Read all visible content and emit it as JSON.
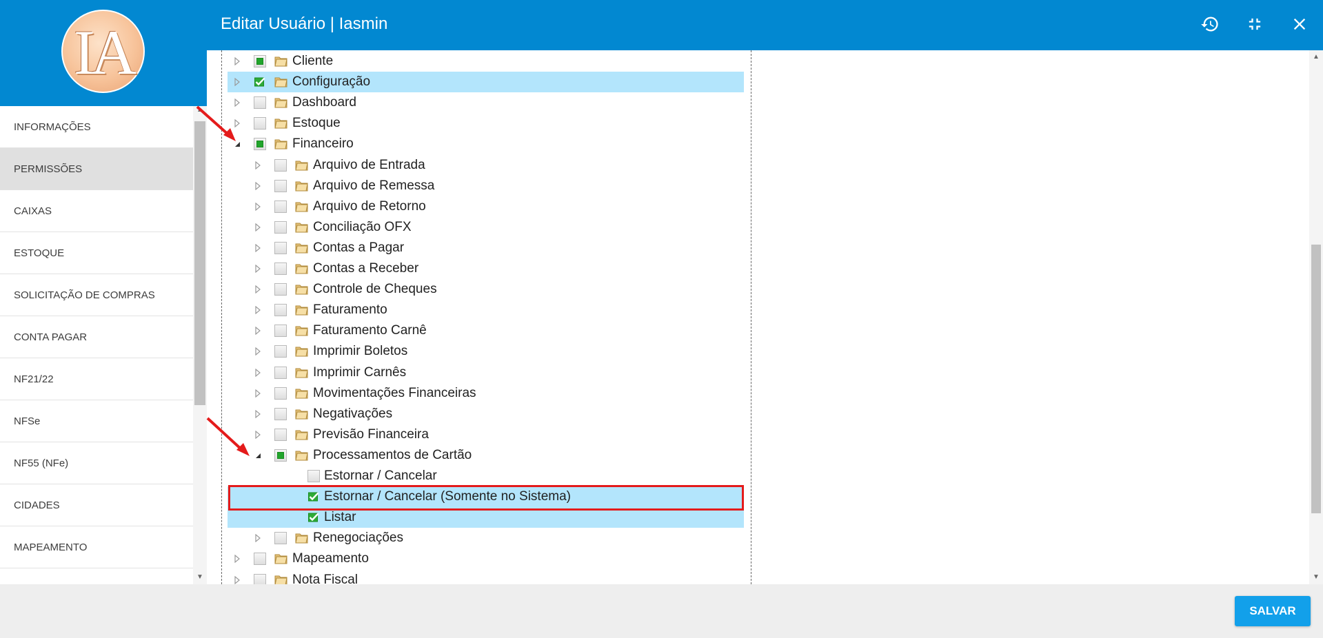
{
  "header": {
    "title": "Editar Usuário | Iasmin",
    "logo_text": "IA",
    "history_icon": "history-icon",
    "collapse_icon": "fullscreen-exit-icon",
    "close_icon": "close-icon",
    "color": "#0288d1"
  },
  "sidebar": {
    "items": [
      {
        "label": "INFORMAÇÕES",
        "active": false
      },
      {
        "label": "PERMISSÕES",
        "active": true
      },
      {
        "label": "CAIXAS",
        "active": false
      },
      {
        "label": "ESTOQUE",
        "active": false
      },
      {
        "label": "SOLICITAÇÃO DE COMPRAS",
        "active": false
      },
      {
        "label": "CONTA PAGAR",
        "active": false
      },
      {
        "label": "NF21/22",
        "active": false
      },
      {
        "label": "NFSe",
        "active": false
      },
      {
        "label": "NF55 (NFe)",
        "active": false
      },
      {
        "label": "CIDADES",
        "active": false
      },
      {
        "label": "MAPEAMENTO",
        "active": false
      }
    ]
  },
  "tree": {
    "nodes": [
      {
        "label": "Cliente",
        "level": 0,
        "expander": "collapsed",
        "check": "partial",
        "folder": true,
        "selected": false
      },
      {
        "label": "Configuração",
        "level": 0,
        "expander": "collapsed",
        "check": "checked",
        "folder": true,
        "selected": true
      },
      {
        "label": "Dashboard",
        "level": 0,
        "expander": "collapsed",
        "check": "unchecked",
        "folder": true,
        "selected": false
      },
      {
        "label": "Estoque",
        "level": 0,
        "expander": "collapsed",
        "check": "unchecked",
        "folder": true,
        "selected": false
      },
      {
        "label": "Financeiro",
        "level": 0,
        "expander": "expanded",
        "check": "partial",
        "folder": true,
        "selected": false
      },
      {
        "label": "Arquivo de Entrada",
        "level": 1,
        "expander": "collapsed",
        "check": "unchecked",
        "folder": true,
        "selected": false
      },
      {
        "label": "Arquivo de Remessa",
        "level": 1,
        "expander": "collapsed",
        "check": "unchecked",
        "folder": true,
        "selected": false
      },
      {
        "label": "Arquivo de Retorno",
        "level": 1,
        "expander": "collapsed",
        "check": "unchecked",
        "folder": true,
        "selected": false
      },
      {
        "label": "Conciliação OFX",
        "level": 1,
        "expander": "collapsed",
        "check": "unchecked",
        "folder": true,
        "selected": false
      },
      {
        "label": "Contas a Pagar",
        "level": 1,
        "expander": "collapsed",
        "check": "unchecked",
        "folder": true,
        "selected": false
      },
      {
        "label": "Contas a Receber",
        "level": 1,
        "expander": "collapsed",
        "check": "unchecked",
        "folder": true,
        "selected": false
      },
      {
        "label": "Controle de Cheques",
        "level": 1,
        "expander": "collapsed",
        "check": "unchecked",
        "folder": true,
        "selected": false
      },
      {
        "label": "Faturamento",
        "level": 1,
        "expander": "collapsed",
        "check": "unchecked",
        "folder": true,
        "selected": false
      },
      {
        "label": "Faturamento Carnê",
        "level": 1,
        "expander": "collapsed",
        "check": "unchecked",
        "folder": true,
        "selected": false
      },
      {
        "label": "Imprimir Boletos",
        "level": 1,
        "expander": "collapsed",
        "check": "unchecked",
        "folder": true,
        "selected": false
      },
      {
        "label": "Imprimir Carnês",
        "level": 1,
        "expander": "collapsed",
        "check": "unchecked",
        "folder": true,
        "selected": false
      },
      {
        "label": "Movimentações Financeiras",
        "level": 1,
        "expander": "collapsed",
        "check": "unchecked",
        "folder": true,
        "selected": false
      },
      {
        "label": "Negativações",
        "level": 1,
        "expander": "collapsed",
        "check": "unchecked",
        "folder": true,
        "selected": false
      },
      {
        "label": "Previsão Financeira",
        "level": 1,
        "expander": "collapsed",
        "check": "unchecked",
        "folder": true,
        "selected": false
      },
      {
        "label": "Processamentos de Cartão",
        "level": 1,
        "expander": "expanded",
        "check": "partial",
        "folder": true,
        "selected": false
      },
      {
        "label": "Estornar / Cancelar",
        "level": 2,
        "expander": "none",
        "check": "unchecked",
        "folder": false,
        "selected": false
      },
      {
        "label": "Estornar / Cancelar (Somente no Sistema)",
        "level": 2,
        "expander": "none",
        "check": "checked",
        "folder": false,
        "selected": true
      },
      {
        "label": "Listar",
        "level": 2,
        "expander": "none",
        "check": "checked",
        "folder": false,
        "selected": true
      },
      {
        "label": "Renegociações",
        "level": 1,
        "expander": "collapsed",
        "check": "unchecked",
        "folder": true,
        "selected": false
      },
      {
        "label": "Mapeamento",
        "level": 0,
        "expander": "collapsed",
        "check": "unchecked",
        "folder": true,
        "selected": false
      },
      {
        "label": "Nota Fiscal",
        "level": 0,
        "expander": "collapsed",
        "check": "unchecked",
        "folder": true,
        "selected": false
      }
    ]
  },
  "footer": {
    "save_label": "SALVAR"
  },
  "colors": {
    "accent": "#0288d1",
    "selection": "#b3e5fc",
    "annotation": "#e41b1b",
    "check_green": "#22a52c"
  }
}
